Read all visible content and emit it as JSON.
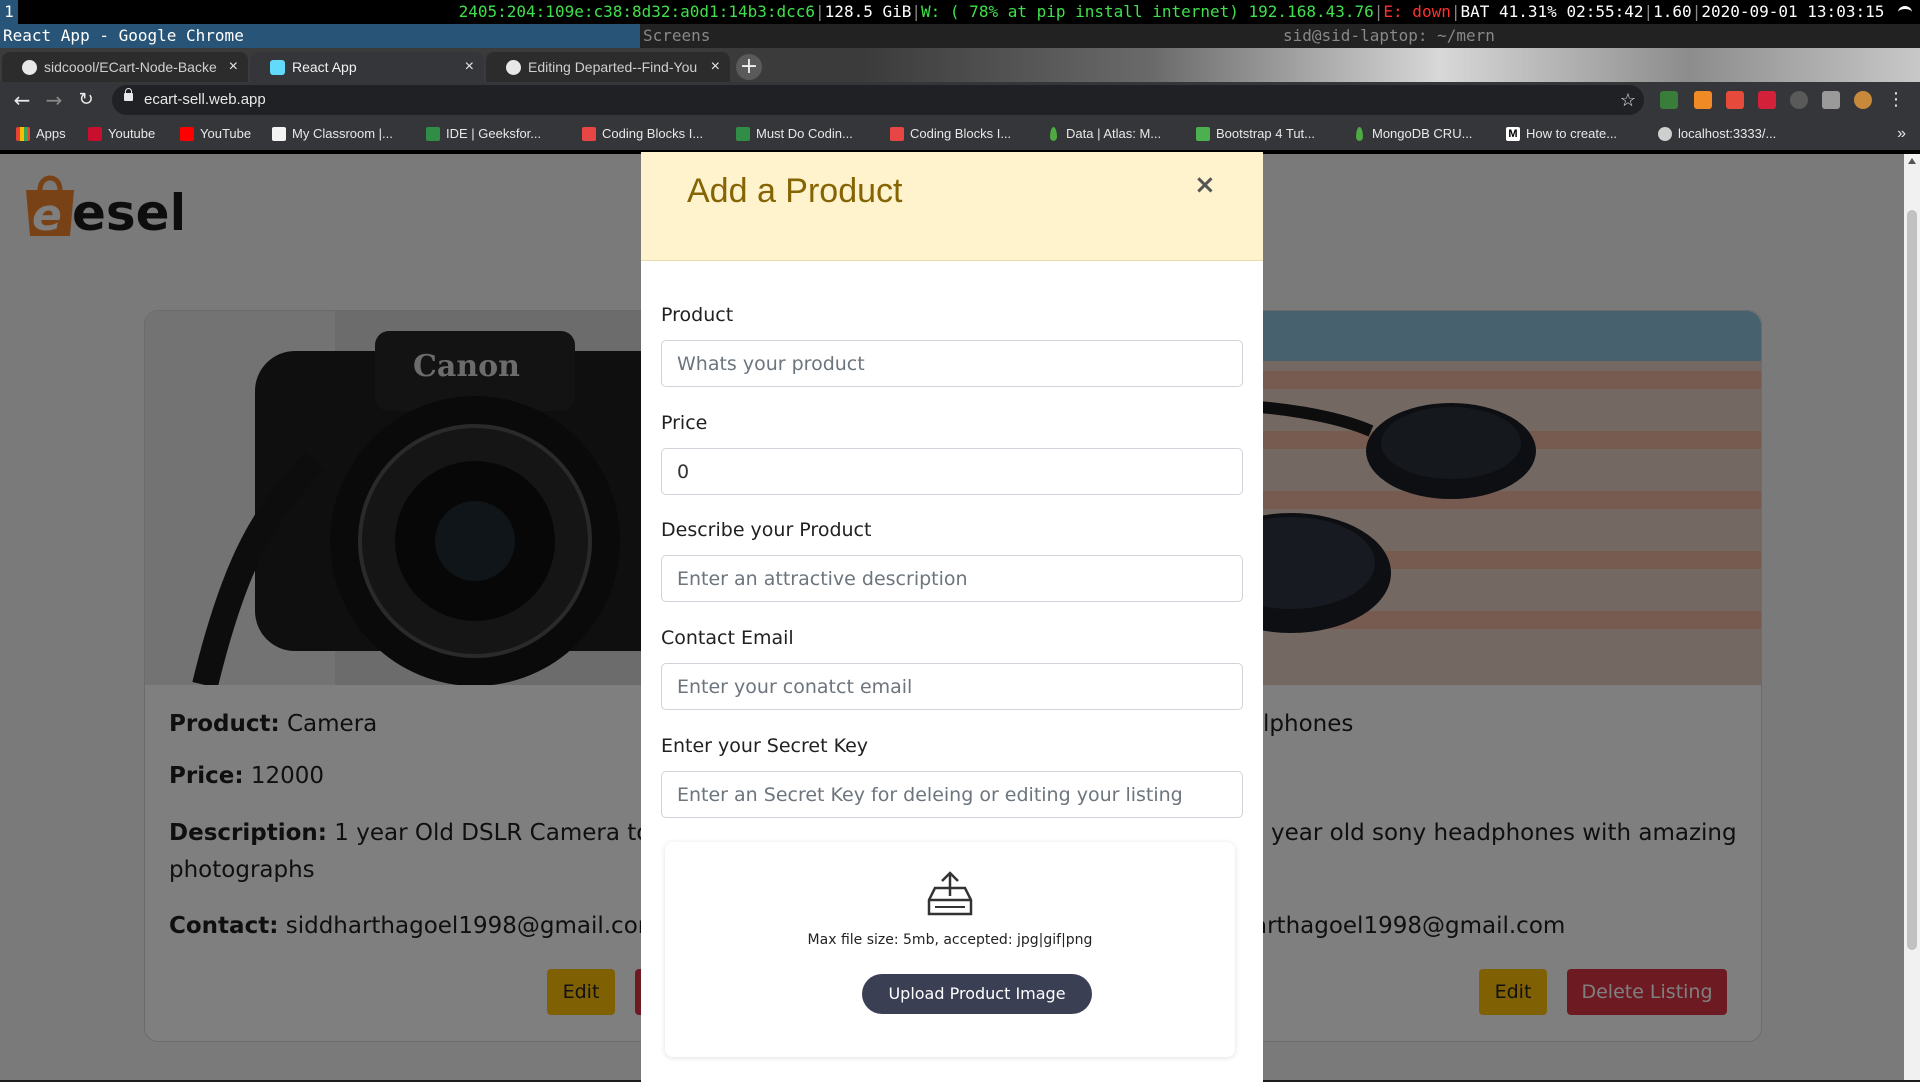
{
  "status_bar": {
    "workspace": "1",
    "ipv6": "2405:204:109e:c38:8d32:a0d1:14b3:dcc6",
    "disk": "128.5 GiB",
    "wifi": "W: ( 78% at pip install internet) 192.168.43.76",
    "ethernet": "E: down",
    "battery": "BAT 41.31% 02:55:42",
    "load": "1.60",
    "datetime": "2020-09-01 13:03:15"
  },
  "window_titles": {
    "chrome": "React App - Google Chrome",
    "screens": "Screens",
    "terminal": "sid@sid-laptop: ~/mern"
  },
  "browser": {
    "tabs": [
      {
        "label": "sidcoool/ECart-Node-Backe",
        "active": false
      },
      {
        "label": "React App",
        "active": true
      },
      {
        "label": "Editing Departed--Find-You",
        "active": false
      }
    ],
    "url": "ecart-sell.web.app",
    "bookmarks": [
      "Apps",
      "Youtube",
      "YouTube",
      "My Classroom |...",
      "IDE | Geeksfor...",
      "Coding Blocks I...",
      "Must Do Codin...",
      "Coding Blocks I...",
      "Data | Atlas: M...",
      "Bootstrap 4 Tut...",
      "MongoDB CRU...",
      "How to create...",
      "localhost:3333/..."
    ],
    "bookmarks_more": "»"
  },
  "page": {
    "logo_text": "esell",
    "products": [
      {
        "product_label": "Product:",
        "product": "Camera",
        "price_label": "Price:",
        "price": "12000",
        "description_label": "Description:",
        "description_line1": "1 year Old DSLR Camera to t",
        "description_line2": "photographs",
        "contact_label": "Contact:",
        "contact": "siddharthagoel1998@gmail.com",
        "edit": "Edit",
        "delete": ""
      },
      {
        "product_label": "",
        "product": "lphones",
        "price_label": "",
        "price": "",
        "description_label": "",
        "description_line1": "year old sony headphones with amazing",
        "description_line2": "",
        "contact_label": "",
        "contact": "arthagoel1998@gmail.com",
        "edit": "Edit",
        "delete": "Delete Listing"
      }
    ]
  },
  "modal": {
    "title": "Add a Product",
    "close": "×",
    "fields": [
      {
        "label": "Product",
        "placeholder": "Whats your product",
        "value": ""
      },
      {
        "label": "Price",
        "placeholder": "",
        "value": "0"
      },
      {
        "label": "Describe your Product",
        "placeholder": "Enter an attractive description",
        "value": ""
      },
      {
        "label": "Contact Email",
        "placeholder": "Enter your conatct email",
        "value": ""
      },
      {
        "label": "Enter your Secret Key",
        "placeholder": "Enter an Secret Key for deleing or editing your listing",
        "value": ""
      }
    ],
    "upload": {
      "hint": "Max file size: 5mb, accepted: jpg|gif|png",
      "button": "Upload Product Image"
    }
  },
  "colors": {
    "modal_header_bg": "#fff3cd",
    "modal_title": "#856404",
    "edit_button": "#ffc107",
    "delete_button": "#dc3545",
    "upload_button": "#3b3f54",
    "logo_orange": "#f0842c"
  }
}
